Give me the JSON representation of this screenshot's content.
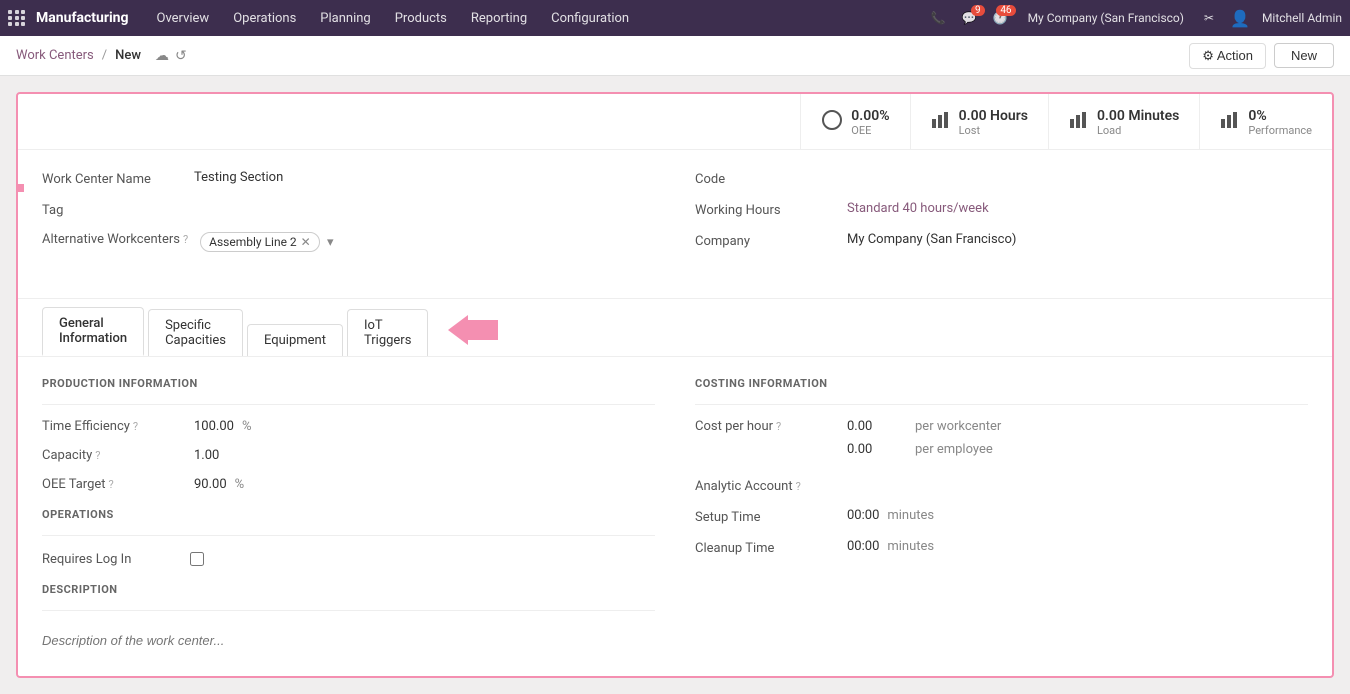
{
  "app": {
    "name": "Manufacturing",
    "nav_items": [
      "Overview",
      "Operations",
      "Planning",
      "Products",
      "Reporting",
      "Configuration"
    ]
  },
  "topbar": {
    "company": "My Company (San Francisco)",
    "user": "Mitchell Admin",
    "chat_badge": "9",
    "clock_badge": "46"
  },
  "breadcrumb": {
    "parent": "Work Centers",
    "current": "New"
  },
  "toolbar": {
    "action_label": "⚙ Action",
    "new_label": "New"
  },
  "stats": [
    {
      "icon": "pie",
      "value": "0.00%",
      "label": "OEE"
    },
    {
      "icon": "bar",
      "value": "0.00 Hours",
      "label": "Lost"
    },
    {
      "icon": "bar",
      "value": "0.00 Minutes",
      "label": "Load"
    },
    {
      "icon": "bar",
      "value": "0%",
      "label": "Performance"
    }
  ],
  "general_info": {
    "work_center_name_label": "Work Center Name",
    "work_center_name_value": "Testing Section",
    "tag_label": "Tag",
    "alternative_label": "Alternative Workcenters",
    "alternative_help": "?",
    "alternative_tag": "Assembly Line 2",
    "code_label": "Code",
    "code_value": "",
    "working_hours_label": "Working Hours",
    "working_hours_value": "Standard 40 hours/week",
    "company_label": "Company",
    "company_value": "My Company (San Francisco)"
  },
  "tabs": [
    {
      "id": "general",
      "label": "General Information",
      "active": true
    },
    {
      "id": "specific",
      "label": "Specific Capacities",
      "active": false
    },
    {
      "id": "equipment",
      "label": "Equipment",
      "active": false
    },
    {
      "id": "iot",
      "label": "IoT Triggers",
      "active": false
    }
  ],
  "production_info": {
    "section_title": "PRODUCTION INFORMATION",
    "efficiency_label": "Time Efficiency",
    "efficiency_help": "?",
    "efficiency_value": "100.00",
    "efficiency_unit": "%",
    "capacity_label": "Capacity",
    "capacity_help": "?",
    "capacity_value": "1.00",
    "oee_label": "OEE Target",
    "oee_help": "?",
    "oee_value": "90.00",
    "oee_unit": "%"
  },
  "operations_info": {
    "section_title": "OPERATIONS",
    "requires_log_label": "Requires Log In"
  },
  "description_info": {
    "section_title": "DESCRIPTION",
    "placeholder": "Description of the work center..."
  },
  "costing_info": {
    "section_title": "COSTING INFORMATION",
    "cost_hour_label": "Cost per hour",
    "cost_hour_help": "?",
    "cost_hour_value": "0.00",
    "cost_hour_unit": "per workcenter",
    "cost_employee_value": "0.00",
    "cost_employee_unit": "per employee",
    "analytic_label": "Analytic Account",
    "analytic_help": "?",
    "analytic_value": "",
    "setup_label": "Setup Time",
    "setup_value": "00:00",
    "setup_unit": "minutes",
    "cleanup_label": "Cleanup Time",
    "cleanup_value": "00:00",
    "cleanup_unit": "minutes"
  }
}
